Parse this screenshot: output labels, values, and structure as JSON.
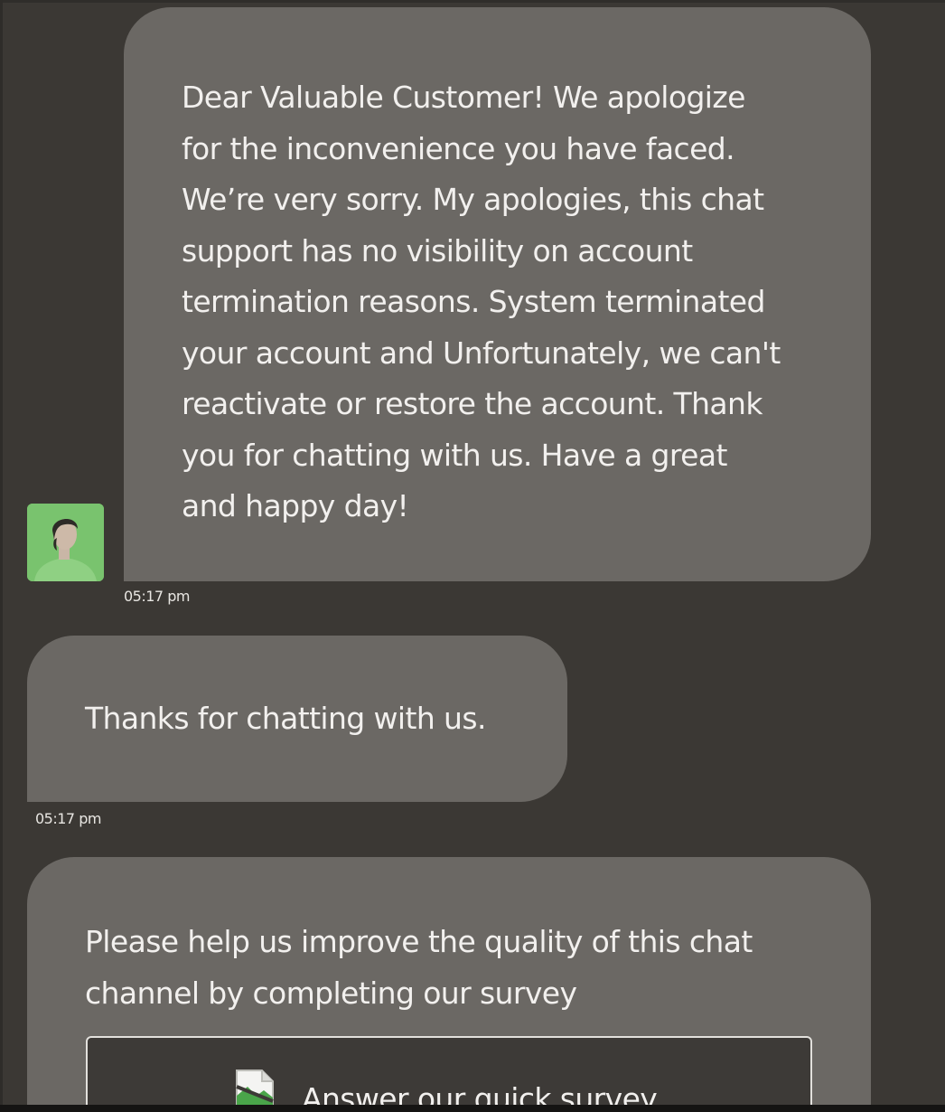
{
  "messages": [
    {
      "text": "Dear Valuable Customer! We apologize\nfor the inconvenience you have faced.\nWe’re very sorry. My apologies, this chat\nsupport has no visibility on account\ntermination reasons. System terminated\nyour account and Unfortunately, we can't\nreactivate or restore the account. Thank\nyou for chatting with us. Have a great\nand happy day!",
      "time": "05:17 pm"
    },
    {
      "text": "Thanks for chatting with us.",
      "time": "05:17 pm"
    },
    {
      "text": "Please help us improve the quality of this chat\nchannel by completing our survey",
      "button_label": "Answer our quick survey"
    }
  ],
  "icons": {
    "avatar": "agent-avatar",
    "survey_button_image": "broken-image-icon"
  },
  "colors": {
    "background": "#3b3834",
    "bubble": "#6b6864",
    "text": "#f2f0ee",
    "avatar_bg": "#79c36e"
  }
}
